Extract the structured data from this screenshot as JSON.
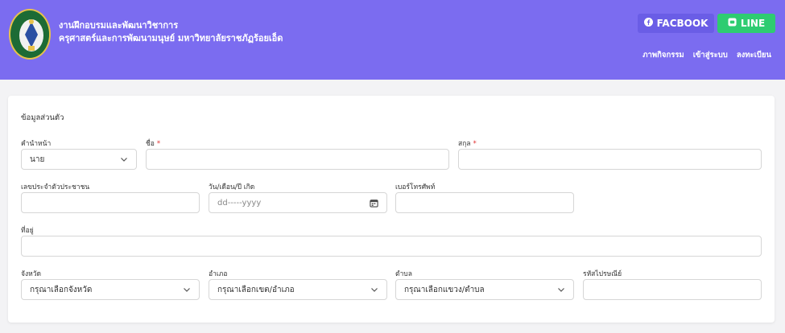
{
  "header": {
    "title_line1": "งานฝึกอบรมและพัฒนาวิชาการ",
    "title_line2": "ครุศาสตร์และการพัฒนามนุษย์ มหาวิทยาลัยราชภัฏร้อยเอ็ด",
    "facebook_label": "FACBOOK",
    "line_label": "LINE",
    "nav": [
      "ภาพกิจกรรม",
      "เข้าสู่ระบบ",
      "ลงทะเบียน"
    ]
  },
  "form": {
    "section_title": "ข้อมูลส่วนตัว",
    "prefix": {
      "label": "คำนำหน้า",
      "value": "นาย"
    },
    "firstname": {
      "label": "ชื่อ",
      "required_mark": "*",
      "value": ""
    },
    "lastname": {
      "label": "สกุล",
      "required_mark": "*",
      "value": ""
    },
    "id_card": {
      "label": "เลขประจำตัวประชาชน",
      "value": ""
    },
    "birthdate": {
      "label": "วัน/เดือน/ปี เกิด",
      "placeholder": "dd-----yyyy"
    },
    "phone": {
      "label": "เบอร์โทรศัพท์",
      "value": ""
    },
    "address": {
      "label": "ที่อยู่",
      "value": ""
    },
    "province": {
      "label": "จังหวัด",
      "value": "กรุณาเลือกจังหวัด"
    },
    "district": {
      "label": "อำเภอ",
      "value": "กรุณาเลือกเขต/อำเภอ"
    },
    "subdistrict": {
      "label": "ตำบล",
      "value": "กรุณาเลือกแขวง/ตำบล"
    },
    "postcode": {
      "label": "รหัสไปรษณีย์",
      "value": ""
    }
  },
  "colors": {
    "header_bg": "#7b6cf0",
    "facebook_bg": "#6a5de6",
    "line_bg": "#2ecc71",
    "required": "#e03131"
  }
}
